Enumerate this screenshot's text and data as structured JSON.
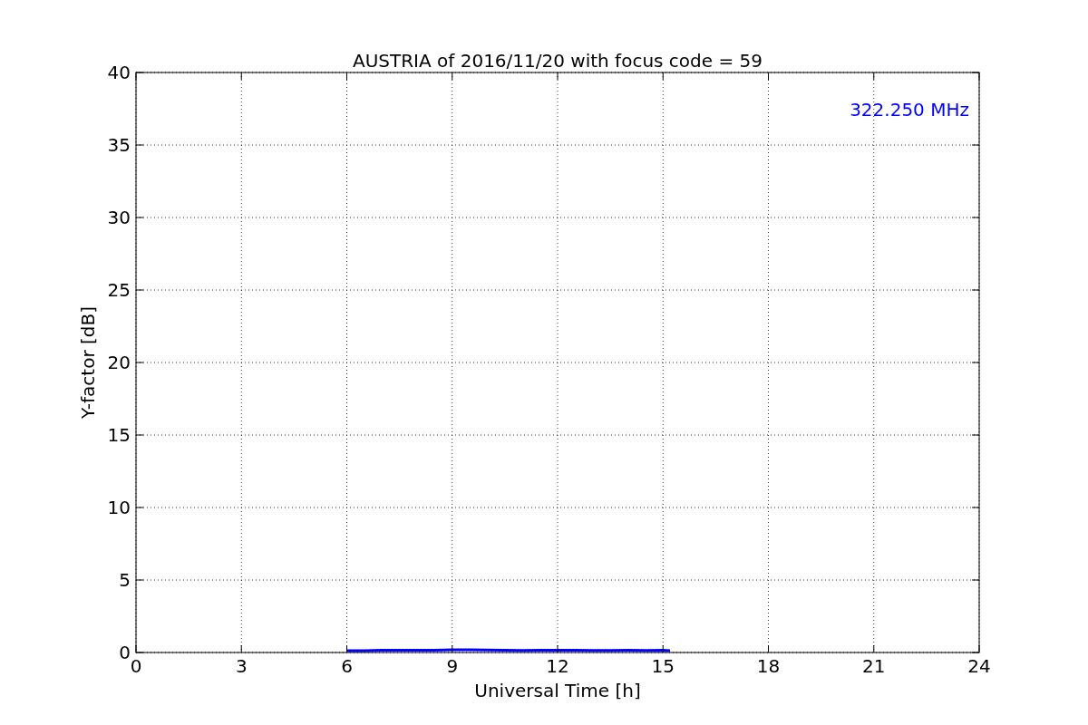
{
  "figure": {
    "chart_data": {
      "type": "line",
      "title": "AUSTRIA of 2016/11/20 with focus code = 59",
      "xlabel": "Universal Time [h]",
      "ylabel": "Y-factor [dB]",
      "x": [
        6,
        6.5,
        7,
        7.5,
        8,
        8.5,
        9,
        9.5,
        10,
        10.5,
        11,
        11.5,
        12,
        12.5,
        13,
        13.5,
        14,
        14.5,
        15,
        15.2
      ],
      "series": [
        {
          "name": "322.250 MHz",
          "color": "#0000ff",
          "values": [
            0.12,
            0.13,
            0.15,
            0.16,
            0.15,
            0.16,
            0.18,
            0.19,
            0.17,
            0.15,
            0.14,
            0.15,
            0.16,
            0.15,
            0.14,
            0.14,
            0.15,
            0.14,
            0.15,
            0.13
          ]
        }
      ],
      "xlim": [
        0,
        24
      ],
      "ylim": [
        0,
        40
      ],
      "xticks": [
        0,
        3,
        6,
        9,
        12,
        15,
        18,
        21,
        24
      ],
      "yticks": [
        0,
        5,
        10,
        15,
        20,
        25,
        30,
        35,
        40
      ],
      "grid": true
    }
  }
}
